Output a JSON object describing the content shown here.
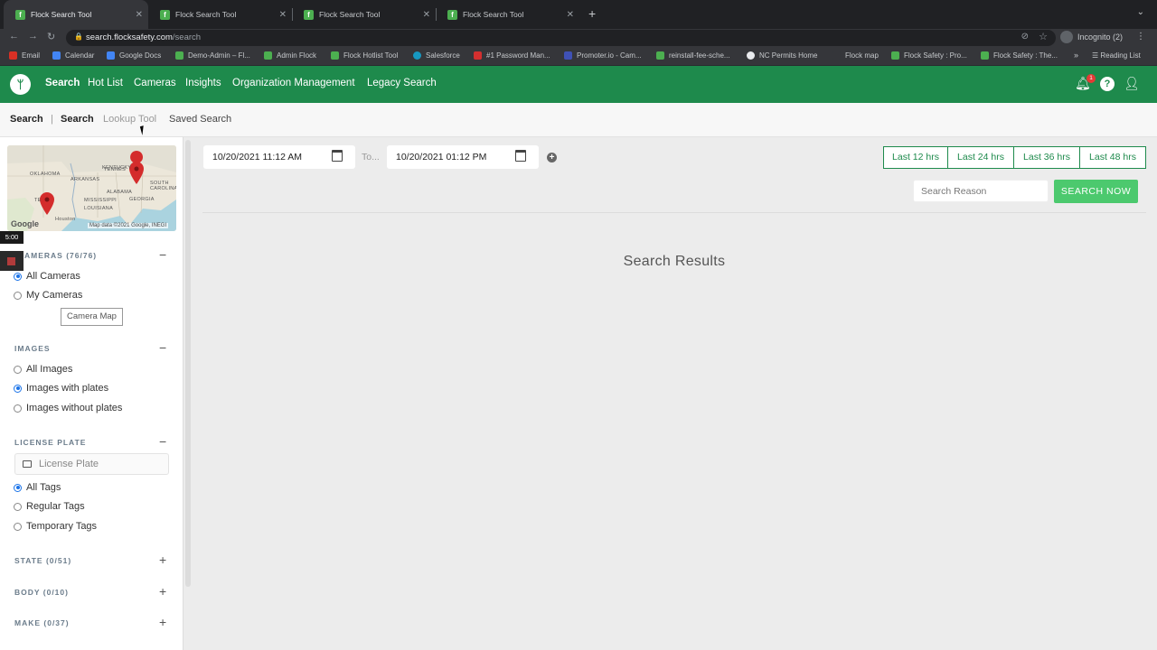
{
  "browser": {
    "tabs": [
      {
        "label": "Flock Search Tool",
        "active": true
      },
      {
        "label": "Flock Search Tool",
        "active": false
      },
      {
        "label": "Flock Search Tool",
        "active": false
      },
      {
        "label": "Flock Search Tool",
        "active": false
      }
    ],
    "url_host": "search.flocksafety.com",
    "url_path": "/search",
    "profile_label": "Incognito (2)",
    "bookmarks": [
      {
        "label": "Email",
        "color": "#d93025"
      },
      {
        "label": "Calendar",
        "color": "#4285f4"
      },
      {
        "label": "Google Docs",
        "color": "#4285f4"
      },
      {
        "label": "Demo-Admin – Fl...",
        "color": "#4caf50"
      },
      {
        "label": "Admin Flock",
        "color": "#4caf50"
      },
      {
        "label": "Flock Hotlist Tool",
        "color": "#4caf50"
      },
      {
        "label": "Salesforce",
        "color": "#1798c1"
      },
      {
        "label": "#1 Password Man...",
        "color": "#d32f2f"
      },
      {
        "label": "Promoter.io - Cam...",
        "color": "#3f51b5"
      },
      {
        "label": "reinstall-fee-sche...",
        "color": "#4caf50"
      },
      {
        "label": "NC Permits Home",
        "color": "#e8eaed"
      },
      {
        "label": "Flock map",
        "color": "#35363a"
      },
      {
        "label": "Flock Safety : Pro...",
        "color": "#4caf50"
      },
      {
        "label": "Flock Safety : The...",
        "color": "#4caf50"
      }
    ],
    "more_bookmarks": "»",
    "reading_list": "Reading List"
  },
  "header": {
    "nav": [
      "Search",
      "Hot List",
      "Cameras",
      "Insights",
      "Organization Management",
      "Legacy Search"
    ],
    "notification_count": "1",
    "help": "?",
    "brand_color": "#1e8a4c"
  },
  "subnav": {
    "title": "Search",
    "divider": "|",
    "tabs": [
      "Search",
      "Lookup Tool",
      "Saved Search"
    ]
  },
  "sidebar": {
    "map": {
      "labels": [
        "KENTUCKY",
        "TENNES",
        "OKLAHOMA",
        "ARKANSAS",
        "ALABAMA",
        "GEORGIA",
        "SOUTH CAROLINA",
        "MISSISSIPPI",
        "LOUISIANA",
        "Houston",
        "TE"
      ],
      "google": "Google",
      "credit": "Map data ©2021 Google, INEGI"
    },
    "timer": "5:00",
    "cameras": {
      "title": "AMERAS (76/76)",
      "toggle": "−",
      "options": [
        "All Cameras",
        "My Cameras"
      ],
      "selected": 0,
      "camera_map_button": "Camera Map"
    },
    "images": {
      "title": "IMAGES",
      "toggle": "−",
      "options": [
        "All Images",
        "Images with plates",
        "Images without plates"
      ],
      "selected": 1
    },
    "license_plate": {
      "title": "LICENSE PLATE",
      "toggle": "−",
      "placeholder": "License Plate",
      "options": [
        "All Tags",
        "Regular Tags",
        "Temporary Tags"
      ],
      "selected": 0
    },
    "collapsed_sections": [
      {
        "title": "STATE (0/51)",
        "toggle": "+"
      },
      {
        "title": "BODY (0/10)",
        "toggle": "+"
      },
      {
        "title": "MAKE (0/37)",
        "toggle": "+"
      }
    ]
  },
  "main": {
    "from_datetime": "10/20/2021 11:12 AM",
    "to_label": "To...",
    "to_datetime": "10/20/2021 01:12 PM",
    "quick_ranges": [
      "Last 12 hrs",
      "Last 24 hrs",
      "Last 36 hrs",
      "Last 48 hrs"
    ],
    "search_reason_placeholder": "Search Reason",
    "search_button": "SEARCH NOW",
    "results_title": "Search Results"
  }
}
